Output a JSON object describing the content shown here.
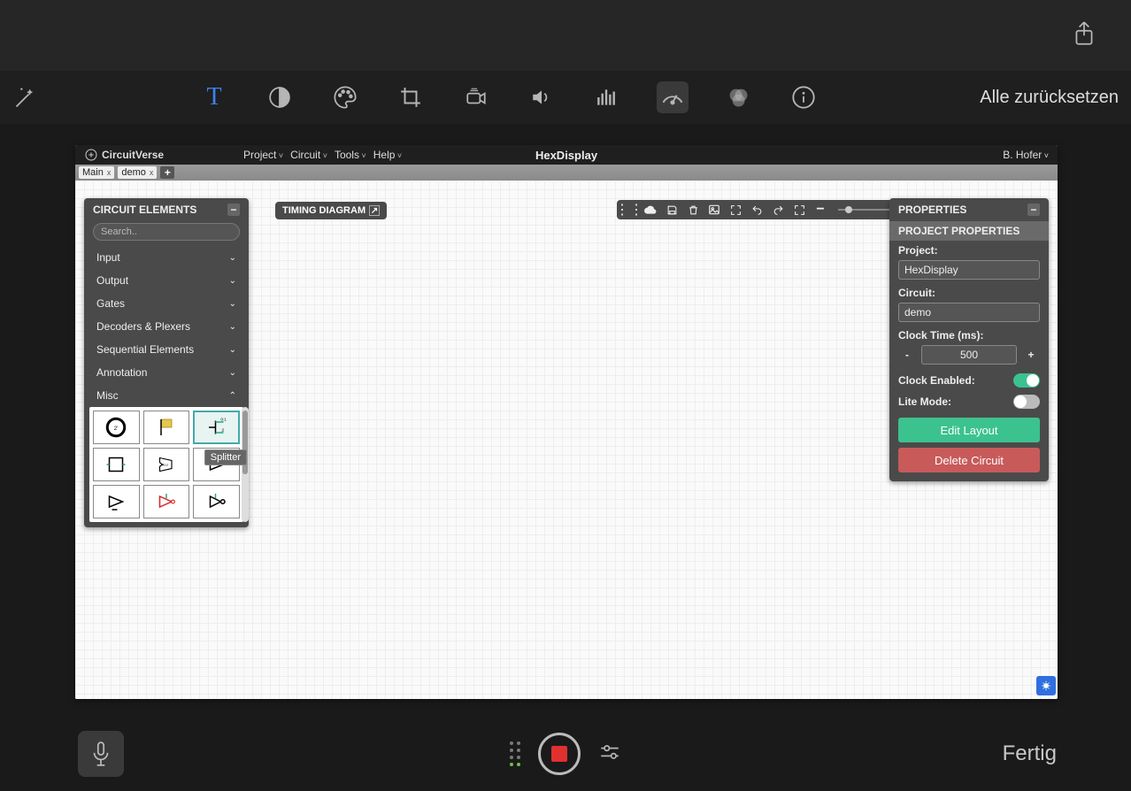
{
  "outer": {
    "reset_label": "Alle zurücksetzen",
    "done_label": "Fertig"
  },
  "app": {
    "brand": "CircuitVerse",
    "menus": [
      "Project",
      "Circuit",
      "Tools",
      "Help"
    ],
    "title": "HexDisplay",
    "user": "B. Hofer",
    "tabs": [
      {
        "label": "Main"
      },
      {
        "label": "demo"
      }
    ]
  },
  "left_panel": {
    "title": "CIRCUIT ELEMENTS",
    "search_placeholder": "Search..",
    "categories": [
      {
        "label": "Input",
        "open": false
      },
      {
        "label": "Output",
        "open": false
      },
      {
        "label": "Gates",
        "open": false
      },
      {
        "label": "Decoders & Plexers",
        "open": false
      },
      {
        "label": "Sequential Elements",
        "open": false
      },
      {
        "label": "Annotation",
        "open": false
      },
      {
        "label": "Misc",
        "open": true
      }
    ],
    "misc_tooltip": "Splitter"
  },
  "timing_chip": "TIMING DIAGRAM",
  "right_panel": {
    "title": "PROPERTIES",
    "subheader": "PROJECT PROPERTIES",
    "project_label": "Project:",
    "project_value": "HexDisplay",
    "circuit_label": "Circuit:",
    "circuit_value": "demo",
    "clock_time_label": "Clock Time (ms):",
    "clock_time_value": "500",
    "clock_enabled_label": "Clock Enabled:",
    "clock_enabled": true,
    "lite_mode_label": "Lite Mode:",
    "lite_mode": false,
    "edit_layout_label": "Edit Layout",
    "delete_circuit_label": "Delete Circuit"
  }
}
